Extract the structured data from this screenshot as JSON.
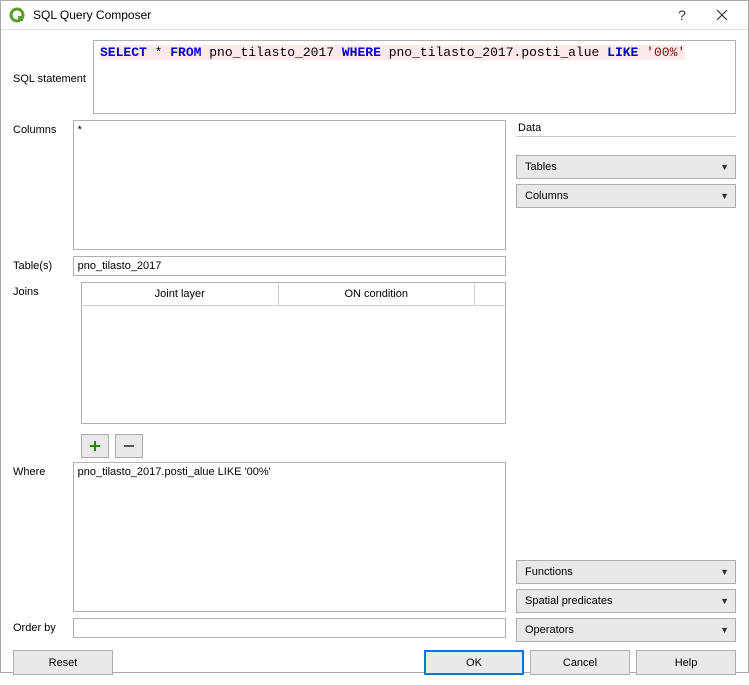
{
  "window": {
    "title": "SQL Query Composer"
  },
  "sql": {
    "label": "SQL statement",
    "kw_select": "SELECT",
    "star": " * ",
    "kw_from": "FROM",
    "t1": " pno_tilasto_2017 ",
    "kw_where": "WHERE",
    "t2": " pno_tilasto_2017.posti_alue ",
    "kw_like": "LIKE",
    "sp": " ",
    "lit": "'00%'"
  },
  "columns": {
    "label": "Columns",
    "value": "*"
  },
  "tables": {
    "label": "Table(s)",
    "value": "pno_tilasto_2017"
  },
  "joins": {
    "label": "Joins",
    "h1": "Joint layer",
    "h2": "ON condition"
  },
  "where": {
    "label": "Where",
    "value": "pno_tilasto_2017.posti_alue LIKE '00%'"
  },
  "orderby": {
    "label": "Order by",
    "value": ""
  },
  "data": {
    "section": "Data",
    "tables": "Tables",
    "columns": "Columns",
    "functions": "Functions",
    "spatial": "Spatial predicates",
    "operators": "Operators"
  },
  "buttons": {
    "reset": "Reset",
    "ok": "OK",
    "cancel": "Cancel",
    "help": "Help"
  }
}
